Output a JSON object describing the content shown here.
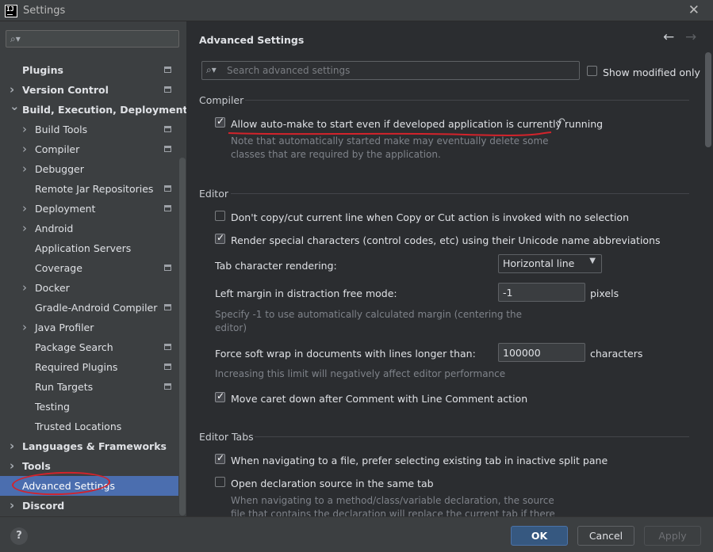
{
  "window": {
    "title": "Settings",
    "app_icon": "intellij-idea-icon",
    "close_icon": "close-icon"
  },
  "sidebar": {
    "search_placeholder": "",
    "items": [
      {
        "label": "Plugins",
        "level": 0,
        "expandable": false,
        "bold": true,
        "project_icon": true
      },
      {
        "label": "Version Control",
        "level": 0,
        "expandable": true,
        "expanded": false,
        "bold": true,
        "project_icon": true
      },
      {
        "label": "Build, Execution, Deployment",
        "level": 0,
        "expandable": true,
        "expanded": true,
        "bold": true,
        "project_icon": false
      },
      {
        "label": "Build Tools",
        "level": 1,
        "expandable": true,
        "project_icon": true
      },
      {
        "label": "Compiler",
        "level": 1,
        "expandable": true,
        "project_icon": true
      },
      {
        "label": "Debugger",
        "level": 1,
        "expandable": true,
        "project_icon": false
      },
      {
        "label": "Remote Jar Repositories",
        "level": 1,
        "expandable": false,
        "project_icon": true
      },
      {
        "label": "Deployment",
        "level": 1,
        "expandable": true,
        "project_icon": true
      },
      {
        "label": "Android",
        "level": 1,
        "expandable": true,
        "project_icon": false
      },
      {
        "label": "Application Servers",
        "level": 1,
        "expandable": false,
        "project_icon": false
      },
      {
        "label": "Coverage",
        "level": 1,
        "expandable": false,
        "project_icon": true
      },
      {
        "label": "Docker",
        "level": 1,
        "expandable": true,
        "project_icon": false
      },
      {
        "label": "Gradle-Android Compiler",
        "level": 1,
        "expandable": false,
        "project_icon": true
      },
      {
        "label": "Java Profiler",
        "level": 1,
        "expandable": true,
        "project_icon": false
      },
      {
        "label": "Package Search",
        "level": 1,
        "expandable": false,
        "project_icon": true
      },
      {
        "label": "Required Plugins",
        "level": 1,
        "expandable": false,
        "project_icon": true
      },
      {
        "label": "Run Targets",
        "level": 1,
        "expandable": false,
        "project_icon": true
      },
      {
        "label": "Testing",
        "level": 1,
        "expandable": false,
        "project_icon": false
      },
      {
        "label": "Trusted Locations",
        "level": 1,
        "expandable": false,
        "project_icon": false
      },
      {
        "label": "Languages & Frameworks",
        "level": 0,
        "expandable": true,
        "expanded": false,
        "bold": true,
        "project_icon": false
      },
      {
        "label": "Tools",
        "level": 0,
        "expandable": true,
        "expanded": false,
        "bold": true,
        "project_icon": false
      },
      {
        "label": "Advanced Settings",
        "level": 0,
        "expandable": false,
        "bold": false,
        "selected": true,
        "project_icon": false
      },
      {
        "label": "Discord",
        "level": 0,
        "expandable": true,
        "expanded": false,
        "bold": true,
        "project_icon": false
      }
    ]
  },
  "main": {
    "title": "Advanced Settings",
    "back_icon": "arrow-left-icon",
    "forward_icon": "arrow-right-icon",
    "search_placeholder": "Search advanced settings",
    "show_modified_label": "Show modified only",
    "show_modified_checked": false,
    "sections": {
      "compiler": {
        "title": "Compiler",
        "auto_make_label": "Allow auto-make to start even if developed application is currently running",
        "auto_make_checked": true,
        "auto_make_note_1": "Note that automatically started make may eventually delete some",
        "auto_make_note_2": "classes that are required by the application."
      },
      "editor": {
        "title": "Editor",
        "copy_cut_label": "Don't copy/cut current line when Copy or Cut action is invoked with no selection",
        "copy_cut_checked": false,
        "special_chars_label": "Render special characters (control codes, etc) using their Unicode name abbreviations",
        "special_chars_checked": true,
        "tab_rendering_label": "Tab character rendering:",
        "tab_rendering_value": "Horizontal line",
        "left_margin_label": "Left margin in distraction free mode:",
        "left_margin_value": "-1",
        "left_margin_unit": "pixels",
        "left_margin_note_1": "Specify -1 to use automatically calculated margin (centering the",
        "left_margin_note_2": "editor)",
        "soft_wrap_label": "Force soft wrap in documents with lines longer than:",
        "soft_wrap_value": "100000",
        "soft_wrap_unit": "characters",
        "soft_wrap_note": "Increasing this limit will negatively affect editor performance",
        "caret_down_label": "Move caret down after Comment with Line Comment action",
        "caret_down_checked": true
      },
      "editor_tabs": {
        "title": "Editor Tabs",
        "prefer_existing_label": "When navigating to a file, prefer selecting existing tab in inactive split pane",
        "prefer_existing_checked": true,
        "open_same_tab_label": "Open declaration source in the same tab",
        "open_same_tab_checked": false,
        "open_same_tab_note_1": "When navigating to a method/class/variable declaration, the source",
        "open_same_tab_note_2": "file that contains the declaration will replace the current tab if there"
      }
    }
  },
  "footer": {
    "help_label": "?",
    "ok_label": "OK",
    "cancel_label": "Cancel",
    "apply_label": "Apply"
  },
  "colors": {
    "accent": "#4b6eaf",
    "primary_button": "#365880",
    "annotation": "#d3232b"
  }
}
